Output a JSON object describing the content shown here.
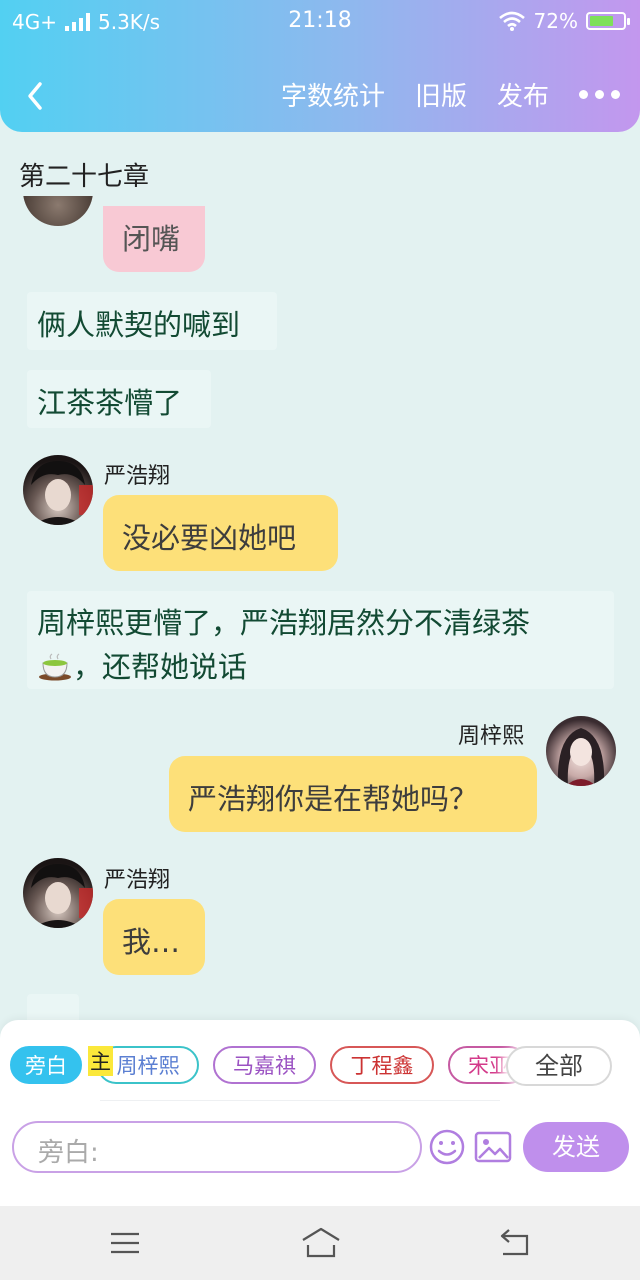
{
  "status_bar": {
    "network": "4G+",
    "speed": "5.3K/s",
    "time": "21:18",
    "battery": "72%",
    "battery_level": 0.72
  },
  "app_bar": {
    "word_count": "字数统计",
    "old_version": "旧版",
    "publish": "发布"
  },
  "chapter_title": "第二十七章",
  "messages": [
    {
      "type": "bubble",
      "speaker": "",
      "text": "闭嘴",
      "color": "#f8c9d4"
    },
    {
      "type": "narration",
      "text": "俩人默契的喊到"
    },
    {
      "type": "narration",
      "text": "江茶茶懵了"
    },
    {
      "type": "bubble",
      "speaker": "严浩翔",
      "text": "没必要凶她吧",
      "color": "#fde079"
    },
    {
      "type": "narration",
      "line1": "周梓熙更懵了，严浩翔居然分不清绿茶",
      "line2": "，还帮她说话"
    },
    {
      "type": "bubble",
      "speaker": "周梓熙",
      "text": "严浩翔你是在帮她吗？",
      "color": "#fde079"
    },
    {
      "type": "bubble",
      "speaker": "严浩翔",
      "text": "我…",
      "color": "#fde079"
    }
  ],
  "characters": {
    "chips": [
      "旁白",
      "周梓熙",
      "马嘉祺",
      "丁程鑫",
      "宋亚"
    ],
    "main_mark": "主",
    "all": "全部"
  },
  "composer": {
    "placeholder": "旁白:",
    "send": "发送"
  },
  "colors": {
    "header_start": "#52d0f2",
    "header_end": "#c397ee",
    "background": "#e3f2f1",
    "send_button": "#bf8fec",
    "narrator_chip": "#34c2ee"
  }
}
